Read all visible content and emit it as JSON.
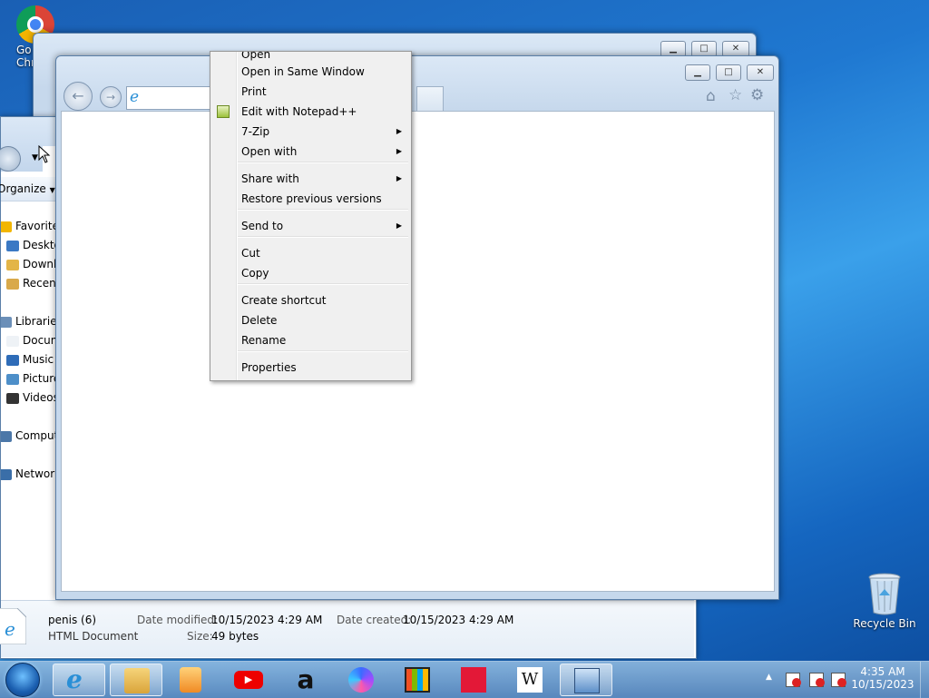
{
  "desktop": {
    "chrome_label_line1": "Go",
    "chrome_label_line2": "Chr",
    "recycle_bin_label": "Recycle Bin"
  },
  "explorer": {
    "organize_label": "Organize",
    "sidebar": [
      {
        "label": "Favorites",
        "icon": "star-icon"
      },
      {
        "label": "Deskto",
        "icon": "desktop-icon"
      },
      {
        "label": "Downl",
        "icon": "downloads-icon"
      },
      {
        "label": "Recent",
        "icon": "recent-places-icon"
      },
      {
        "label": "Libraries",
        "icon": "libraries-icon"
      },
      {
        "label": "Docun",
        "icon": "documents-icon"
      },
      {
        "label": "Music",
        "icon": "music-icon"
      },
      {
        "label": "Picture",
        "icon": "pictures-icon"
      },
      {
        "label": "Videos",
        "icon": "videos-icon"
      },
      {
        "label": "Comput",
        "icon": "computer-icon"
      },
      {
        "label": "Network",
        "icon": "network-icon"
      }
    ],
    "details": {
      "file_name": "penis (6)",
      "file_type": "HTML Document",
      "date_modified_label": "Date modified:",
      "date_modified_value": "10/15/2023 4:29 AM",
      "date_created_label": "Date created:",
      "date_created_value": "10/15/2023 4:29 AM",
      "size_label": "Size:",
      "size_value": "49 bytes"
    }
  },
  "context_menu": {
    "items": [
      {
        "label": "Open",
        "submenu": false
      },
      {
        "label": "Open in Same Window",
        "submenu": false
      },
      {
        "label": "Print",
        "submenu": false
      },
      {
        "label": "Edit with Notepad++",
        "submenu": false,
        "icon": "notepad-plus-plus-icon"
      },
      {
        "label": "7-Zip",
        "submenu": true
      },
      {
        "label": "Open with",
        "submenu": true
      },
      {
        "label": "Share with",
        "submenu": true
      },
      {
        "label": "Restore previous versions",
        "submenu": false
      },
      {
        "label": "Send to",
        "submenu": true
      },
      {
        "label": "Cut",
        "submenu": false
      },
      {
        "label": "Copy",
        "submenu": false
      },
      {
        "label": "Create shortcut",
        "submenu": false
      },
      {
        "label": "Delete",
        "submenu": false
      },
      {
        "label": "Rename",
        "submenu": false
      },
      {
        "label": "Properties",
        "submenu": false
      }
    ],
    "submenu_arrow": "▶"
  },
  "window_controls": {
    "minimize": "▁",
    "maximize": "□",
    "close": "✕"
  },
  "taskbar": {
    "apps": [
      "start-orb",
      "internet-explorer-icon",
      "file-explorer-icon",
      "media-player-icon",
      "youtube-icon",
      "amazon-icon",
      "copilot-icon",
      "microsoft-store-icon",
      "bank-of-america-icon",
      "wikipedia-icon",
      "remote-desktop-icon"
    ],
    "amazon_glyph": "a",
    "wikipedia_glyph": "W",
    "time": "4:35 AM",
    "date": "10/15/2023",
    "tray_show_hidden": "▲"
  }
}
